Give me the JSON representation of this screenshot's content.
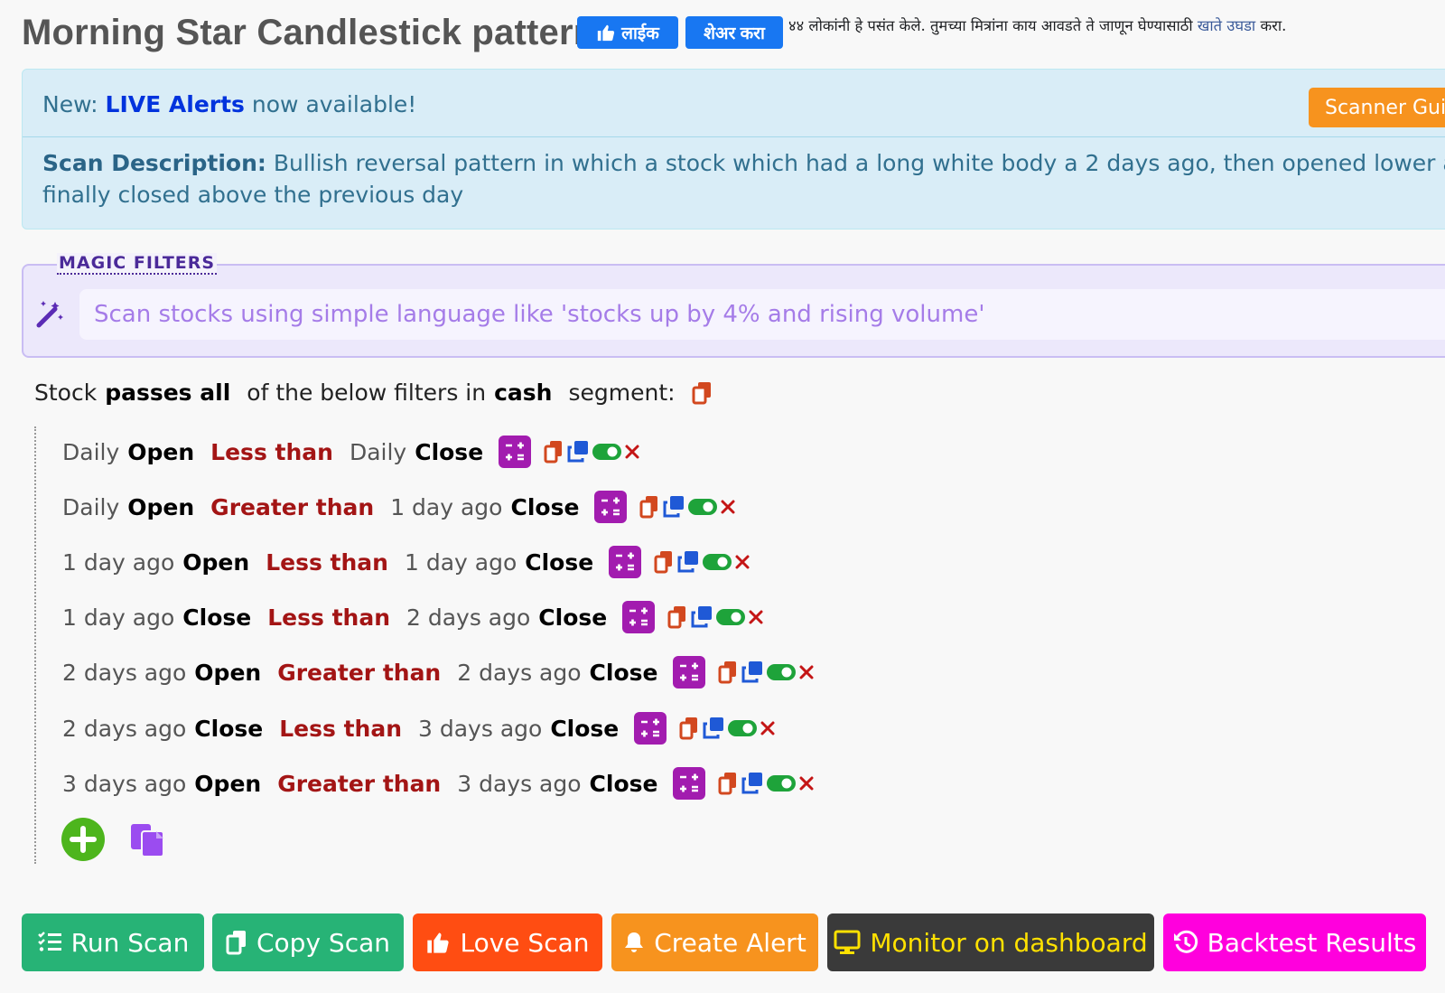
{
  "page_title": "Morning Star Candlestick pattern",
  "facebook": {
    "like_label": "लाईक",
    "share_label": "शेअर करा",
    "social_text": "४४ लोकांनी हे पसंत केले. तुमच्या मित्रांना काय आवडते ते जाणून घेण्यासाठी",
    "link_text": "खाते उघडा",
    "suffix": "करा."
  },
  "alert": {
    "new_prefix": "New:",
    "live_label": "LIVE Alerts",
    "new_suffix": "now available!",
    "scanner_guide_label": "Scanner Guide",
    "desc_label": "Scan Description:",
    "desc_text": "Bullish reversal pattern in which a stock which had a long white body a 2 days ago,  then opened lower and finally closed above the previous day"
  },
  "magic_filters": {
    "legend": "MAGIC FILTERS",
    "placeholder": "Scan stocks using simple language like 'stocks up by 4% and rising volume'"
  },
  "summary": {
    "stock": "Stock",
    "passes": "passes all",
    "of_below": "of the below filters in",
    "segment_value": "cash",
    "segment_word": "segment:"
  },
  "filters": [
    {
      "lhs_period": "Daily",
      "lhs_field": "Open",
      "operator": "Less than",
      "rhs_period": "Daily",
      "rhs_field": "Close"
    },
    {
      "lhs_period": "Daily",
      "lhs_field": "Open",
      "operator": "Greater than",
      "rhs_period": "1 day ago",
      "rhs_field": "Close"
    },
    {
      "lhs_period": "1 day ago",
      "lhs_field": "Open",
      "operator": "Less than",
      "rhs_period": "1 day ago",
      "rhs_field": "Close"
    },
    {
      "lhs_period": "1 day ago",
      "lhs_field": "Close",
      "operator": "Less than",
      "rhs_period": "2 days ago",
      "rhs_field": "Close"
    },
    {
      "lhs_period": "2 days ago",
      "lhs_field": "Open",
      "operator": "Greater than",
      "rhs_period": "2 days ago",
      "rhs_field": "Close"
    },
    {
      "lhs_period": "2 days ago",
      "lhs_field": "Close",
      "operator": "Less than",
      "rhs_period": "3 days ago",
      "rhs_field": "Close"
    },
    {
      "lhs_period": "3 days ago",
      "lhs_field": "Open",
      "operator": "Greater than",
      "rhs_period": "3 days ago",
      "rhs_field": "Close"
    }
  ],
  "actions": {
    "run_scan": "Run Scan",
    "copy_scan": "Copy Scan",
    "love_scan": "Love Scan",
    "create_alert": "Create Alert",
    "monitor_dashboard": "Monitor on dashboard",
    "backtest_results": "Backtest Results"
  },
  "colors": {
    "run_scan": "#27b376",
    "copy_scan": "#27b376",
    "love_scan": "#ff4d12",
    "create_alert": "#f7931e",
    "monitor_dashboard": "#3a3a3a",
    "monitor_text": "#ffe100",
    "backtest_results": "#ff00dd",
    "operator": "#a31515",
    "calc_button": "#a21caf",
    "copy_icon": "#d2481f",
    "duplicate_icon": "#1f59d6",
    "toggle_on": "#1ea33a",
    "delete_icon": "#c41515",
    "add_button": "#4db51d",
    "paste_icon": "#9b4cf0"
  },
  "icons": {
    "calc": "calculator-icon",
    "copy": "copy-icon",
    "duplicate": "duplicate-icon",
    "toggle": "toggle-on-icon",
    "delete": "close-icon"
  }
}
